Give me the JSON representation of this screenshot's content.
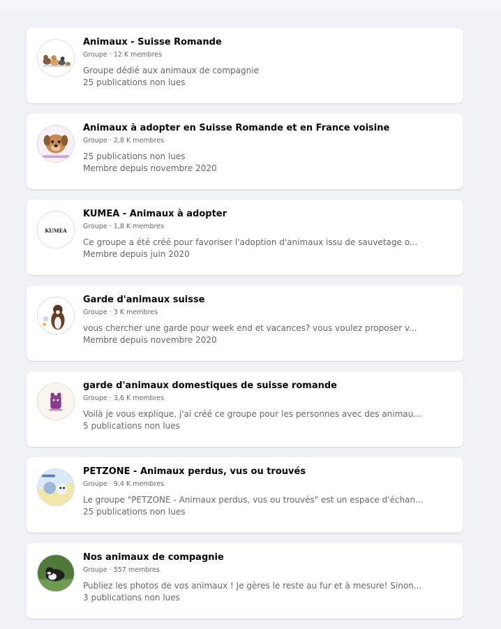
{
  "groups": [
    {
      "name": "Animaux - Suisse Romande",
      "meta": "Groupe · 12 K membres",
      "line1": "Groupe dédié aux animaux de compagnie",
      "line2": "25 publications non lues",
      "avatar_icon": "pets-group-avatar"
    },
    {
      "name": "Animaux à adopter en Suisse Romande et en France voisine",
      "meta": "Groupe · 2,8 K membres",
      "line1": "25 publications non lues",
      "line2": "Membre depuis novembre 2020",
      "avatar_icon": "dog-avatar"
    },
    {
      "name": "KUMEA - Animaux à adopter",
      "meta": "Groupe · 1,8 K membres",
      "line1": "Ce groupe a été créé pour favoriser l'adoption d'animaux issu de sauvetage o...",
      "line2": "Membre depuis juin 2020",
      "avatar_icon": "kumea-logo-avatar",
      "avatar_text": "KUMEA"
    },
    {
      "name": "Garde d'animaux suisse",
      "meta": "Groupe · 3 K membres",
      "line1": "vous chercher une garde pour week end et vacances? vous voulez proposer v...",
      "line2": "Membre depuis novembre 2020",
      "avatar_icon": "dog-avatar"
    },
    {
      "name": "garde d'animaux domestiques de suisse romande",
      "meta": "Groupe · 3,6 K membres",
      "line1": "Voilà je vous explique, j'ai créé ce groupe pour les personnes avec des animau...",
      "line2": "5 publications non lues",
      "avatar_icon": "pet-illustration-avatar"
    },
    {
      "name": "PETZONE - Animaux perdus, vus ou trouvés",
      "meta": "Groupe · 9,4 K membres",
      "line1": "Le groupe \"PETZONE - Animaux perdus, vus ou trouvés\" est un espace d'échan...",
      "line2": "25 publications non lues",
      "avatar_icon": "petzone-avatar"
    },
    {
      "name": "Nos animaux de compagnie",
      "meta": "Groupe · 557 membres",
      "line1": "Publiez les photos de vos animaux ! Je gères le reste au fur et à mesure! Sinon...",
      "line2": "3 publications non lues",
      "avatar_icon": "dog-photo-avatar"
    }
  ],
  "colors": {
    "background": "#f0f2f5",
    "card": "#ffffff",
    "title": "#050505",
    "secondary": "#65676b"
  }
}
